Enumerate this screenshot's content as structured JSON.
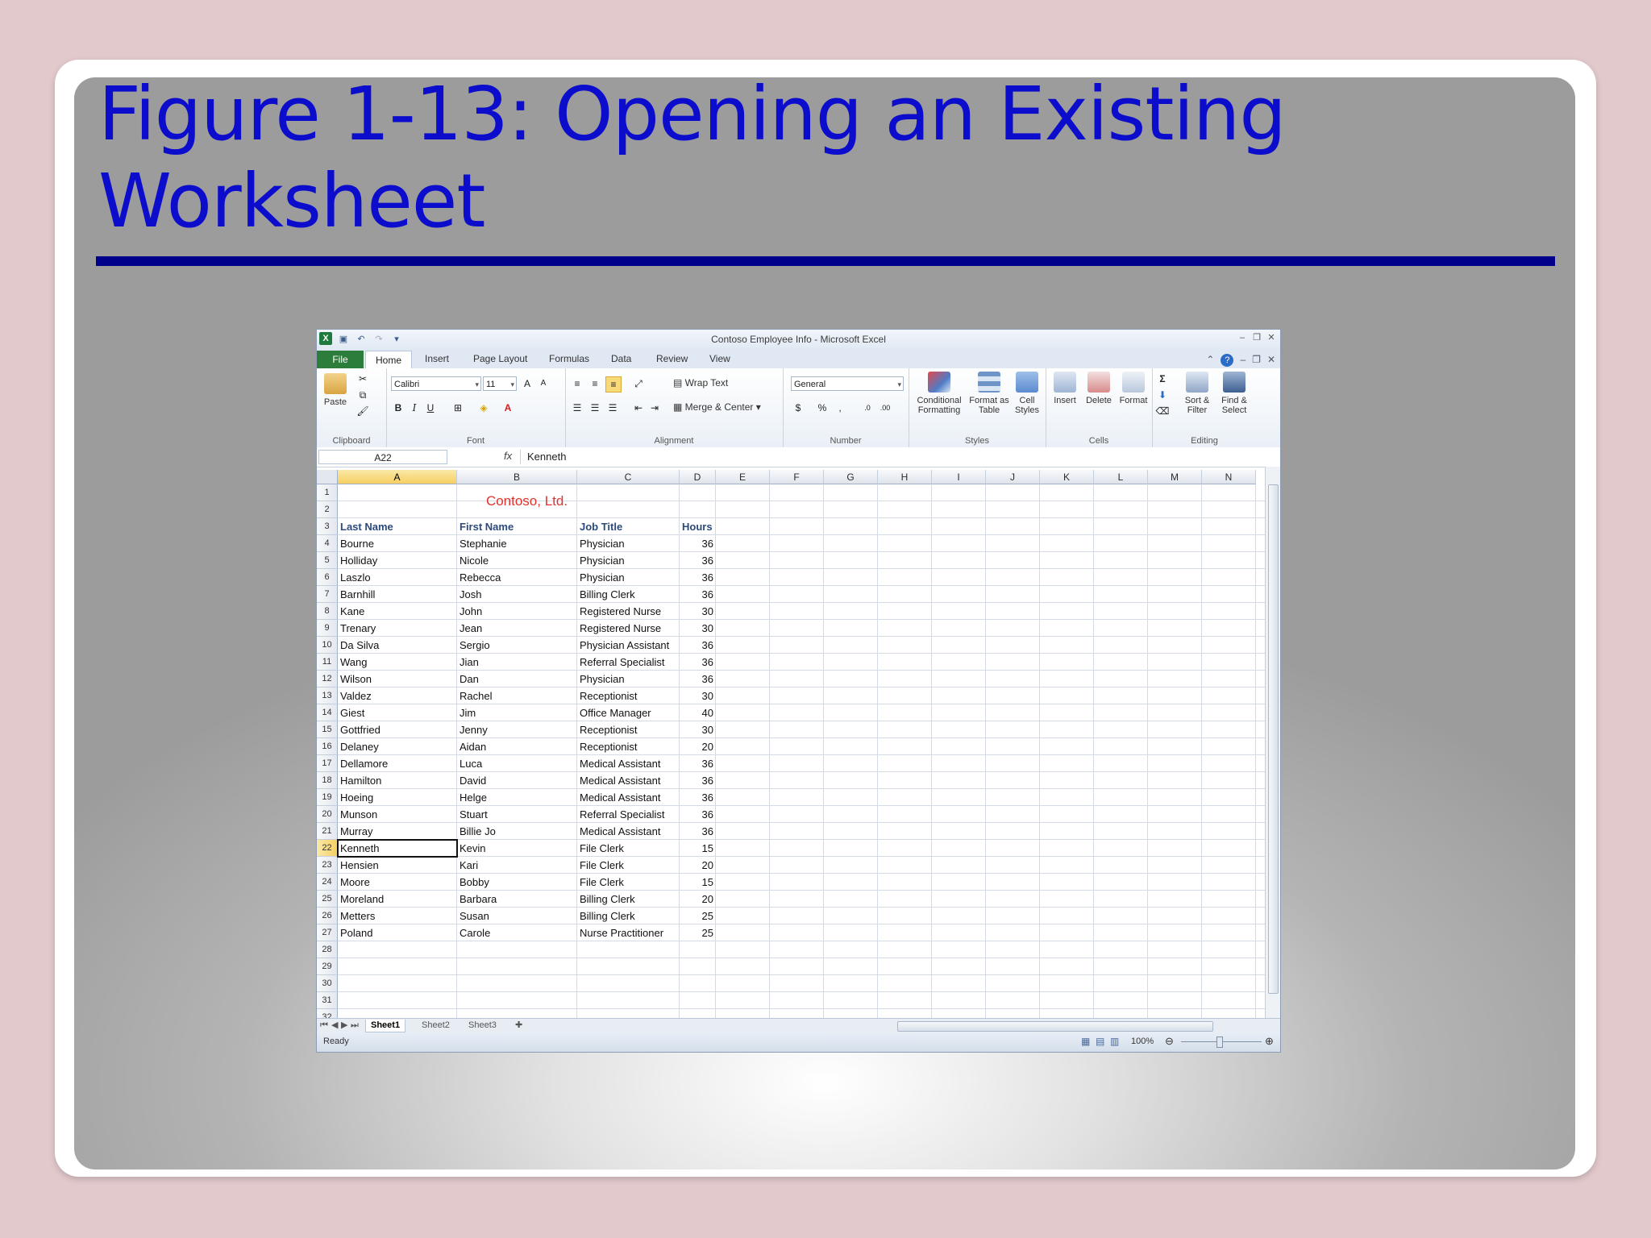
{
  "slide": {
    "title": "Figure 1-13: Opening an Existing Worksheet"
  },
  "excel": {
    "window_title": "Contoso Employee Info - Microsoft Excel",
    "tabs": [
      "File",
      "Home",
      "Insert",
      "Page Layout",
      "Formulas",
      "Data",
      "Review",
      "View"
    ],
    "ribbon": {
      "clipboard": {
        "paste": "Paste",
        "label": "Clipboard"
      },
      "font": {
        "name": "Calibri",
        "size": "11",
        "bold": "B",
        "italic": "I",
        "underline": "U",
        "label": "Font"
      },
      "alignment": {
        "wrap_text": "Wrap Text",
        "merge_center": "Merge & Center",
        "label": "Alignment"
      },
      "number": {
        "format": "General",
        "currency": "$",
        "percent": "%",
        "comma": ",",
        "label": "Number"
      },
      "styles": {
        "conditional": "Conditional Formatting",
        "format_table": "Format as Table",
        "cell_styles": "Cell Styles",
        "label": "Styles"
      },
      "cells": {
        "insert": "Insert",
        "delete": "Delete",
        "format": "Format",
        "label": "Cells"
      },
      "editing": {
        "sort_filter": "Sort & Filter",
        "find_select": "Find & Select",
        "label": "Editing",
        "sigma": "Σ"
      }
    },
    "name_box": "A22",
    "fx": "fx",
    "formula_value": "Kenneth",
    "columns": [
      "A",
      "B",
      "C",
      "D",
      "E",
      "F",
      "G",
      "H",
      "I",
      "J",
      "K",
      "L",
      "M",
      "N"
    ],
    "company": "Contoso, Ltd.",
    "headers": [
      "Last Name",
      "First Name",
      "Job Title",
      "Hours"
    ],
    "rows": [
      [
        "Bourne",
        "Stephanie",
        "Physician",
        "36"
      ],
      [
        "Holliday",
        "Nicole",
        "Physician",
        "36"
      ],
      [
        "Laszlo",
        "Rebecca",
        "Physician",
        "36"
      ],
      [
        "Barnhill",
        "Josh",
        "Billing Clerk",
        "36"
      ],
      [
        "Kane",
        "John",
        "Registered Nurse",
        "30"
      ],
      [
        "Trenary",
        "Jean",
        "Registered Nurse",
        "30"
      ],
      [
        "Da Silva",
        "Sergio",
        "Physician Assistant",
        "36"
      ],
      [
        "Wang",
        "Jian",
        "Referral Specialist",
        "36"
      ],
      [
        "Wilson",
        "Dan",
        "Physician",
        "36"
      ],
      [
        "Valdez",
        "Rachel",
        "Receptionist",
        "30"
      ],
      [
        "Giest",
        "Jim",
        "Office Manager",
        "40"
      ],
      [
        "Gottfried",
        "Jenny",
        "Receptionist",
        "30"
      ],
      [
        "Delaney",
        "Aidan",
        "Receptionist",
        "20"
      ],
      [
        "Dellamore",
        "Luca",
        "Medical Assistant",
        "36"
      ],
      [
        "Hamilton",
        "David",
        "Medical Assistant",
        "36"
      ],
      [
        "Hoeing",
        "Helge",
        "Medical Assistant",
        "36"
      ],
      [
        "Munson",
        "Stuart",
        "Referral Specialist",
        "36"
      ],
      [
        "Murray",
        "Billie Jo",
        "Medical Assistant",
        "36"
      ],
      [
        "Kenneth",
        "Kevin",
        "File Clerk",
        "15"
      ],
      [
        "Hensien",
        "Kari",
        "File Clerk",
        "20"
      ],
      [
        "Moore",
        "Bobby",
        "File Clerk",
        "15"
      ],
      [
        "Moreland",
        "Barbara",
        "Billing Clerk",
        "20"
      ],
      [
        "Metters",
        "Susan",
        "Billing Clerk",
        "25"
      ],
      [
        "Poland",
        "Carole",
        "Nurse Practitioner",
        "25"
      ]
    ],
    "row_numbers": [
      "1",
      "2",
      "3",
      "4",
      "5",
      "6",
      "7",
      "8",
      "9",
      "10",
      "11",
      "12",
      "13",
      "14",
      "15",
      "16",
      "17",
      "18",
      "19",
      "20",
      "21",
      "22",
      "23",
      "24",
      "25",
      "26",
      "27",
      "28",
      "29",
      "30",
      "31",
      "32"
    ],
    "sheet_tabs": [
      "Sheet1",
      "Sheet2",
      "Sheet3"
    ],
    "status": "Ready",
    "zoom": "100%"
  }
}
